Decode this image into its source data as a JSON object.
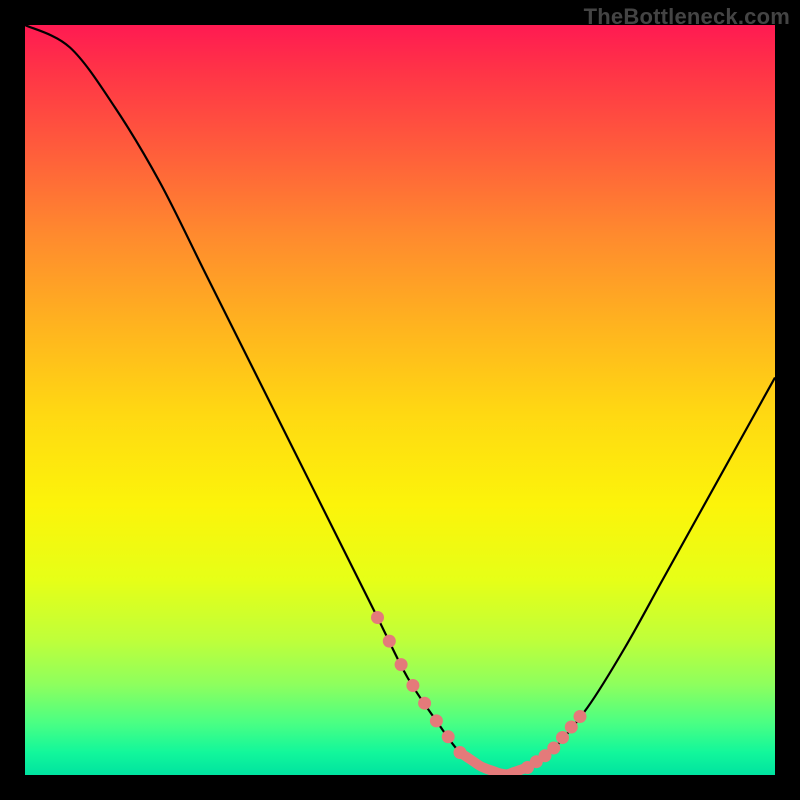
{
  "watermark": "TheBottleneck.com",
  "chart_data": {
    "type": "line",
    "title": "",
    "xlabel": "",
    "ylabel": "",
    "xlim": [
      0,
      100
    ],
    "ylim": [
      0,
      100
    ],
    "x": [
      0,
      6,
      12,
      18,
      24,
      30,
      36,
      42,
      47,
      51,
      55,
      58,
      61,
      64,
      67,
      70,
      75,
      80,
      85,
      90,
      95,
      100
    ],
    "values": [
      100,
      97,
      89,
      79,
      67,
      55,
      43,
      31,
      21,
      13,
      7,
      3,
      1,
      0,
      1,
      3,
      9,
      17,
      26,
      35,
      44,
      53
    ],
    "highlight_x_ranges": [
      [
        47,
        58
      ],
      [
        67,
        74
      ]
    ],
    "flat_x_range": [
      58,
      67
    ]
  }
}
